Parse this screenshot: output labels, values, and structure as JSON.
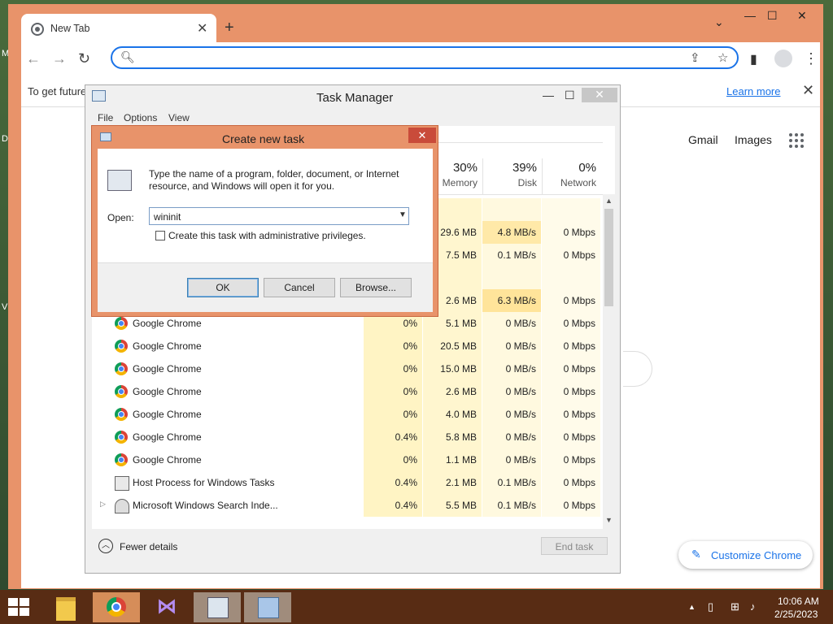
{
  "desktop": {
    "edge_letters": [
      "M",
      "D",
      "V"
    ]
  },
  "browser": {
    "tab_title": "New Tab",
    "tab_close": "✕",
    "new_tab": "+",
    "tab_search": "⌄",
    "win_minimize": "—",
    "win_maximize": "☐",
    "win_close": "✕",
    "nav_back": "←",
    "nav_forward": "→",
    "nav_reload": "↻",
    "omnibox_value": "",
    "infobar_text": "To get future",
    "infobar_link": "Learn more",
    "infobar_close": "✕",
    "ntp": {
      "gmail": "Gmail",
      "images": "Images",
      "customize": "Customize Chrome"
    }
  },
  "task_manager": {
    "title": "Task Manager",
    "minimize": "—",
    "maximize": "☐",
    "close": "✕",
    "menu": [
      "File",
      "Options",
      "View"
    ],
    "columns": [
      {
        "pct": "30%",
        "name": "Memory"
      },
      {
        "pct": "39%",
        "name": "Disk"
      },
      {
        "pct": "0%",
        "name": "Network"
      }
    ],
    "partial_rows": [
      {
        "memory": "29.6 MB",
        "disk": "4.8 MB/s",
        "network": "0 Mbps"
      },
      {
        "memory": "7.5 MB",
        "disk": "0.1 MB/s",
        "network": "0 Mbps"
      },
      {
        "memory": "2.6 MB",
        "disk": "6.3 MB/s",
        "network": "0 Mbps"
      }
    ],
    "rows": [
      {
        "name": "Google Chrome",
        "icon": "chrome",
        "cpu": "0%",
        "memory": "5.1 MB",
        "disk": "0 MB/s",
        "network": "0 Mbps"
      },
      {
        "name": "Google Chrome",
        "icon": "chrome",
        "cpu": "0%",
        "memory": "20.5 MB",
        "disk": "0 MB/s",
        "network": "0 Mbps"
      },
      {
        "name": "Google Chrome",
        "icon": "chrome",
        "cpu": "0%",
        "memory": "15.0 MB",
        "disk": "0 MB/s",
        "network": "0 Mbps"
      },
      {
        "name": "Google Chrome",
        "icon": "chrome",
        "cpu": "0%",
        "memory": "2.6 MB",
        "disk": "0 MB/s",
        "network": "0 Mbps"
      },
      {
        "name": "Google Chrome",
        "icon": "chrome",
        "cpu": "0%",
        "memory": "4.0 MB",
        "disk": "0 MB/s",
        "network": "0 Mbps"
      },
      {
        "name": "Google Chrome",
        "icon": "chrome",
        "cpu": "0.4%",
        "memory": "5.8 MB",
        "disk": "0 MB/s",
        "network": "0 Mbps"
      },
      {
        "name": "Google Chrome",
        "icon": "chrome",
        "cpu": "0%",
        "memory": "1.1 MB",
        "disk": "0 MB/s",
        "network": "0 Mbps"
      },
      {
        "name": "Host Process for Windows Tasks",
        "icon": "host",
        "cpu": "0.4%",
        "memory": "2.1 MB",
        "disk": "0.1 MB/s",
        "network": "0 Mbps"
      },
      {
        "name": "Microsoft Windows Search Inde...",
        "icon": "search",
        "cpu": "0.4%",
        "memory": "5.5 MB",
        "disk": "0.1 MB/s",
        "network": "0 Mbps",
        "expandable": true
      }
    ],
    "fewer_details": "Fewer details",
    "end_task": "End task"
  },
  "dialog": {
    "title": "Create new task",
    "close": "✕",
    "description": "Type the name of a program, folder, document, or Internet resource, and Windows will open it for you.",
    "open_label": "Open:",
    "open_value": "wininit",
    "admin_label": "Create this task with administrative privileges.",
    "ok": "OK",
    "cancel": "Cancel",
    "browse": "Browse..."
  },
  "taskbar": {
    "time": "10:06 AM",
    "date": "2/25/2023"
  }
}
